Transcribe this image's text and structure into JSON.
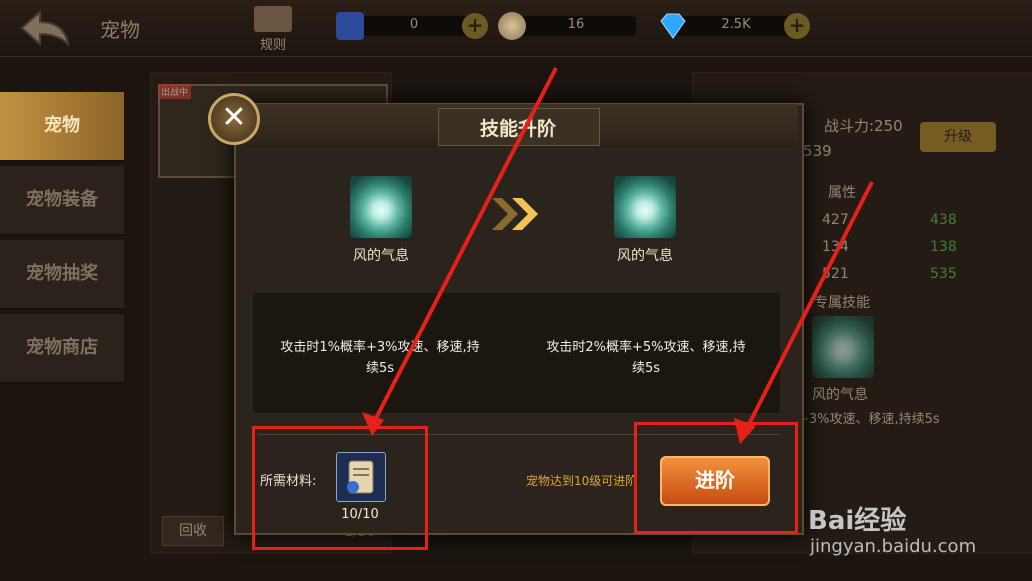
{
  "header": {
    "title": "宠物",
    "rules_label": "规则",
    "resources": [
      {
        "name": "ticket",
        "value": "0",
        "color": "#2b4a9a"
      },
      {
        "name": "coin",
        "value": "16",
        "color": "#b8a27a"
      },
      {
        "name": "diamond",
        "value": "2.5K",
        "color": "#2fa6ff"
      }
    ]
  },
  "sidebar": {
    "tabs": [
      {
        "label": "宠物",
        "active": true
      },
      {
        "label": "宠物装备",
        "active": false
      },
      {
        "label": "宠物抽奖",
        "active": false
      },
      {
        "label": "宠物商店",
        "active": false
      }
    ]
  },
  "background": {
    "power": "战斗力:250",
    "upgrade_label": "升级",
    "exp": "/539",
    "attr_header": "属性",
    "attrs": [
      {
        "from": "427",
        "to": "438"
      },
      {
        "from": "134",
        "to": "138"
      },
      {
        "from": "521",
        "to": "535"
      }
    ],
    "skill_header": "专属技能",
    "skill_name": "风的气息",
    "skill_desc": "+3%攻速、移速,持续5s",
    "recycle_label": "回收",
    "page": "1/50",
    "badge": "出战中"
  },
  "dialog": {
    "title": "技能升阶",
    "current": {
      "name": "风的气息",
      "desc": "攻击时1%概率+3%攻速、移速,持续5s"
    },
    "next": {
      "name": "风的气息",
      "desc": "攻击时2%概率+5%攻速、移速,持续5s"
    },
    "materials_label": "所需材料:",
    "material_count": "10/10",
    "requirement": "宠物达到10级可进阶",
    "advance_label": "进阶"
  },
  "watermark": {
    "line1": "Bai经验",
    "line2": "jingyan.baidu.com"
  },
  "colors": {
    "accent": "#e8201a",
    "gold": "#e0a531",
    "button": "#e06a25"
  }
}
